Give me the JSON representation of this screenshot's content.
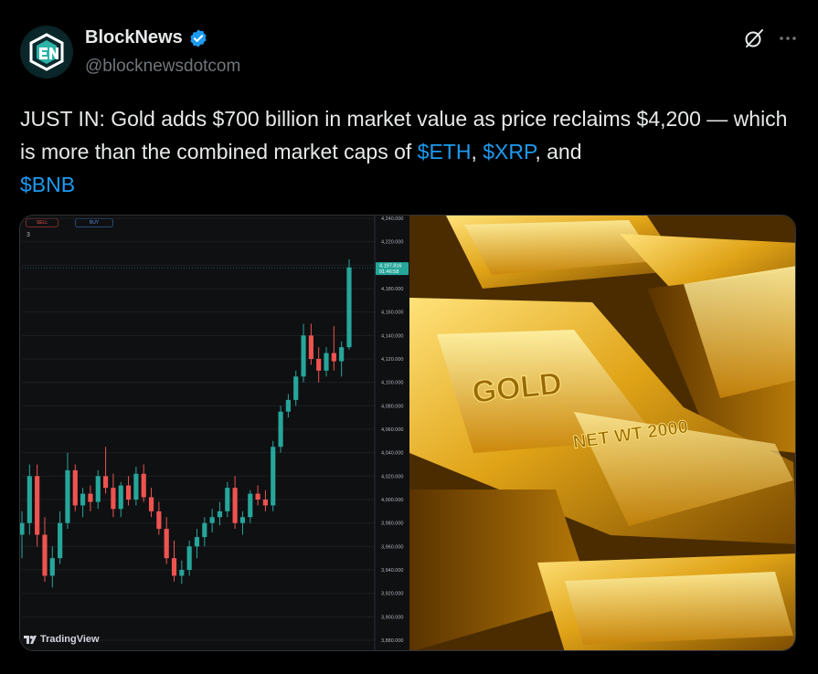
{
  "author": {
    "display_name": "BlockNews",
    "handle": "@blocknewsdotcom",
    "verified": true,
    "avatar_icon": "blocknews-logo-icon"
  },
  "actions": {
    "grok_icon": "grok-icon",
    "more_icon": "more-icon"
  },
  "tweet": {
    "part1": "JUST IN: Gold adds $700 billion in market value as price reclaims $4,200 — which is more than the combined market caps of ",
    "cashtag1": "$ETH",
    "sep1": ", ",
    "cashtag2": "$XRP",
    "sep2": ", and ",
    "cashtag3": "$BNB"
  },
  "media": {
    "chart_watermark": "TradingView",
    "gold_bar_text": [
      "GOLD",
      "NET WT 2000"
    ],
    "trade_buttons": {
      "sell": "SELL",
      "buy": "BUY"
    },
    "interval": "3"
  },
  "chart_data": {
    "type": "candlestick",
    "title": "",
    "y_ticks": [
      "4,240.000",
      "4,220.000",
      "4,200.000",
      "4,180.000",
      "4,160.000",
      "4,140.000",
      "4,120.000",
      "4,100.000",
      "4,080.000",
      "4,060.000",
      "4,040.000",
      "4,020.000",
      "4,000.000",
      "3,980.000",
      "3,960.000",
      "3,940.000",
      "3,920.000",
      "3,900.000",
      "3,880.000"
    ],
    "ylim": [
      3880,
      4240
    ],
    "last_price": "4,197.816",
    "countdown": "01:46:58",
    "colors": {
      "up": "#26a69a",
      "down": "#ef5350"
    },
    "candles": [
      {
        "o": 3970,
        "h": 3990,
        "l": 3950,
        "c": 3980
      },
      {
        "o": 3980,
        "h": 4030,
        "l": 3970,
        "c": 4020
      },
      {
        "o": 4020,
        "h": 4030,
        "l": 3960,
        "c": 3970
      },
      {
        "o": 3970,
        "h": 3985,
        "l": 3930,
        "c": 3935
      },
      {
        "o": 3935,
        "h": 3960,
        "l": 3925,
        "c": 3950
      },
      {
        "o": 3950,
        "h": 3990,
        "l": 3945,
        "c": 3980
      },
      {
        "o": 3980,
        "h": 4040,
        "l": 3975,
        "c": 4025
      },
      {
        "o": 4025,
        "h": 4030,
        "l": 3990,
        "c": 3995
      },
      {
        "o": 3995,
        "h": 4010,
        "l": 3985,
        "c": 4005
      },
      {
        "o": 4005,
        "h": 4012,
        "l": 3990,
        "c": 3998
      },
      {
        "o": 3998,
        "h": 4025,
        "l": 3992,
        "c": 4020
      },
      {
        "o": 4020,
        "h": 4045,
        "l": 4005,
        "c": 4010
      },
      {
        "o": 4010,
        "h": 4022,
        "l": 3985,
        "c": 3992
      },
      {
        "o": 3992,
        "h": 4015,
        "l": 3985,
        "c": 4012
      },
      {
        "o": 4012,
        "h": 4020,
        "l": 3995,
        "c": 4000
      },
      {
        "o": 4000,
        "h": 4028,
        "l": 3995,
        "c": 4022
      },
      {
        "o": 4022,
        "h": 4030,
        "l": 3998,
        "c": 4002
      },
      {
        "o": 4002,
        "h": 4010,
        "l": 3985,
        "c": 3990
      },
      {
        "o": 3990,
        "h": 3998,
        "l": 3970,
        "c": 3975
      },
      {
        "o": 3975,
        "h": 3985,
        "l": 3945,
        "c": 3950
      },
      {
        "o": 3950,
        "h": 3965,
        "l": 3930,
        "c": 3935
      },
      {
        "o": 3935,
        "h": 3948,
        "l": 3928,
        "c": 3940
      },
      {
        "o": 3940,
        "h": 3965,
        "l": 3935,
        "c": 3960
      },
      {
        "o": 3960,
        "h": 3975,
        "l": 3950,
        "c": 3968
      },
      {
        "o": 3968,
        "h": 3985,
        "l": 3960,
        "c": 3980
      },
      {
        "o": 3980,
        "h": 3992,
        "l": 3972,
        "c": 3985
      },
      {
        "o": 3985,
        "h": 3998,
        "l": 3978,
        "c": 3990
      },
      {
        "o": 3990,
        "h": 4015,
        "l": 3985,
        "c": 4010
      },
      {
        "o": 4010,
        "h": 4020,
        "l": 3975,
        "c": 3980
      },
      {
        "o": 3980,
        "h": 3990,
        "l": 3970,
        "c": 3985
      },
      {
        "o": 3985,
        "h": 4008,
        "l": 3980,
        "c": 4005
      },
      {
        "o": 4005,
        "h": 4012,
        "l": 3995,
        "c": 4000
      },
      {
        "o": 4000,
        "h": 4008,
        "l": 3990,
        "c": 3995
      },
      {
        "o": 3995,
        "h": 4050,
        "l": 3990,
        "c": 4045
      },
      {
        "o": 4045,
        "h": 4080,
        "l": 4040,
        "c": 4075
      },
      {
        "o": 4075,
        "h": 4090,
        "l": 4070,
        "c": 4085
      },
      {
        "o": 4085,
        "h": 4110,
        "l": 4080,
        "c": 4105
      },
      {
        "o": 4105,
        "h": 4150,
        "l": 4100,
        "c": 4140
      },
      {
        "o": 4140,
        "h": 4150,
        "l": 4115,
        "c": 4120
      },
      {
        "o": 4120,
        "h": 4130,
        "l": 4100,
        "c": 4110
      },
      {
        "o": 4110,
        "h": 4130,
        "l": 4105,
        "c": 4125
      },
      {
        "o": 4125,
        "h": 4148,
        "l": 4110,
        "c": 4118
      },
      {
        "o": 4118,
        "h": 4135,
        "l": 4105,
        "c": 4130
      },
      {
        "o": 4130,
        "h": 4205,
        "l": 4128,
        "c": 4198
      }
    ]
  }
}
